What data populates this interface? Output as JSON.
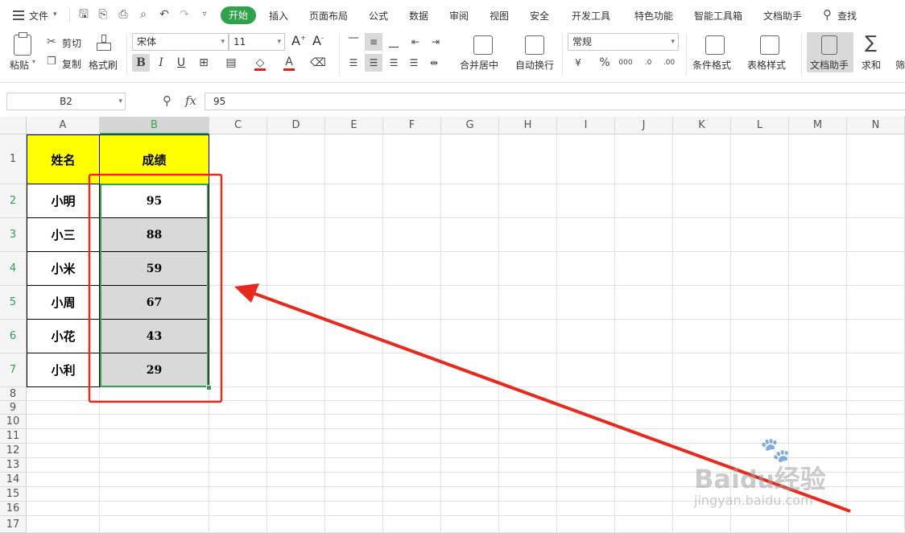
{
  "menubar": {
    "file": "文件",
    "start": "开始",
    "tabs": [
      "插入",
      "页面布局",
      "公式",
      "数据",
      "审阅",
      "视图",
      "安全",
      "开发工具",
      "特色功能",
      "智能工具箱",
      "文档助手"
    ],
    "search": "查找"
  },
  "ribbon": {
    "paste": "粘贴",
    "cut": "剪切",
    "copy": "复制",
    "format_painter": "格式刷",
    "font_name": "宋体",
    "font_size": "11",
    "merge_center": "合并居中",
    "wrap_text": "自动换行",
    "number_format": "常规",
    "conditional_format": "条件格式",
    "table_style": "表格样式",
    "doc_assistant": "文档助手",
    "sum": "求和",
    "filter_partial": "筛",
    "bold": "B",
    "italic": "I",
    "underline": "U",
    "currency": "¥",
    "percent": "%",
    "thousands": "000",
    "fx": "fx"
  },
  "formula_bar": {
    "name_box": "B2",
    "value": "95"
  },
  "sheet": {
    "columns": [
      "A",
      "B",
      "C",
      "D",
      "E",
      "F",
      "G",
      "H",
      "I",
      "J",
      "K",
      "L",
      "M",
      "N"
    ],
    "rows": [
      "1",
      "2",
      "3",
      "4",
      "5",
      "6",
      "7",
      "8",
      "9",
      "10",
      "11",
      "12",
      "13",
      "14",
      "15",
      "16",
      "17"
    ],
    "header": {
      "name": "姓名",
      "score": "成绩"
    },
    "records": [
      {
        "name": "小明",
        "score": "95"
      },
      {
        "name": "小三",
        "score": "88"
      },
      {
        "name": "小米",
        "score": "59"
      },
      {
        "name": "小周",
        "score": "67"
      },
      {
        "name": "小花",
        "score": "43"
      },
      {
        "name": "小利",
        "score": "29"
      }
    ],
    "active_cell": "B2"
  },
  "colors": {
    "accent_green": "#2fa34b",
    "header_fill": "#ffff00",
    "selection_fill": "#d9d9d9",
    "annotation_red": "#e8291c"
  },
  "watermark": "Baidu经验 jingyan.baidu.com"
}
